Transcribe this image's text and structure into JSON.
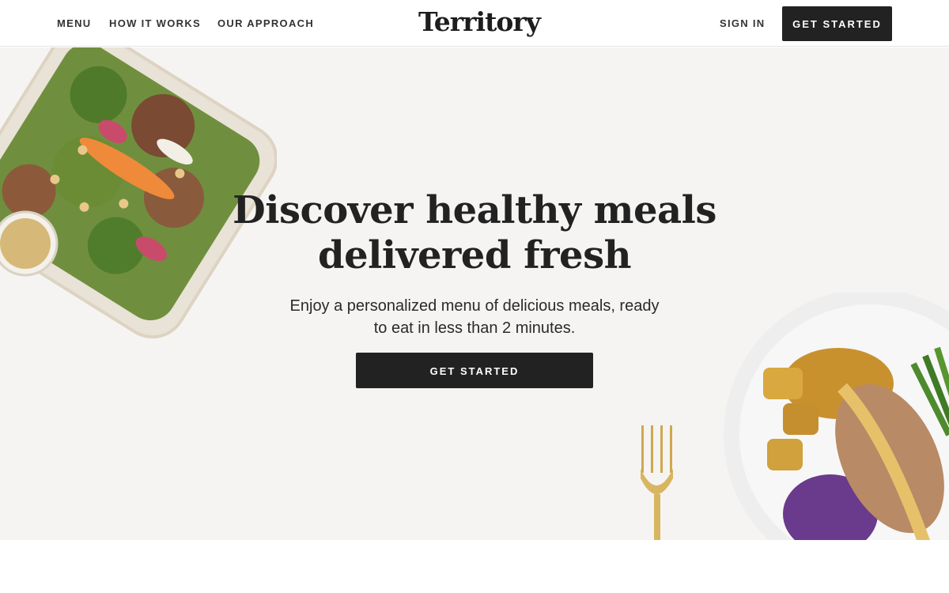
{
  "header": {
    "nav": [
      "MENU",
      "HOW IT WORKS",
      "OUR APPROACH"
    ],
    "logo": "Territory",
    "sign_in": "SIGN IN",
    "cta": "GET STARTED"
  },
  "hero": {
    "title_line1": "Discover healthy meals",
    "title_line2": "delivered fresh",
    "subtitle_line1": "Enjoy a personalized menu of delicious meals, ready",
    "subtitle_line2": "to eat in less than 2 minutes.",
    "cta": "GET STARTED"
  },
  "colors": {
    "hero_bg": "#f5f4f2",
    "button_bg": "#222222",
    "text": "#222222"
  }
}
